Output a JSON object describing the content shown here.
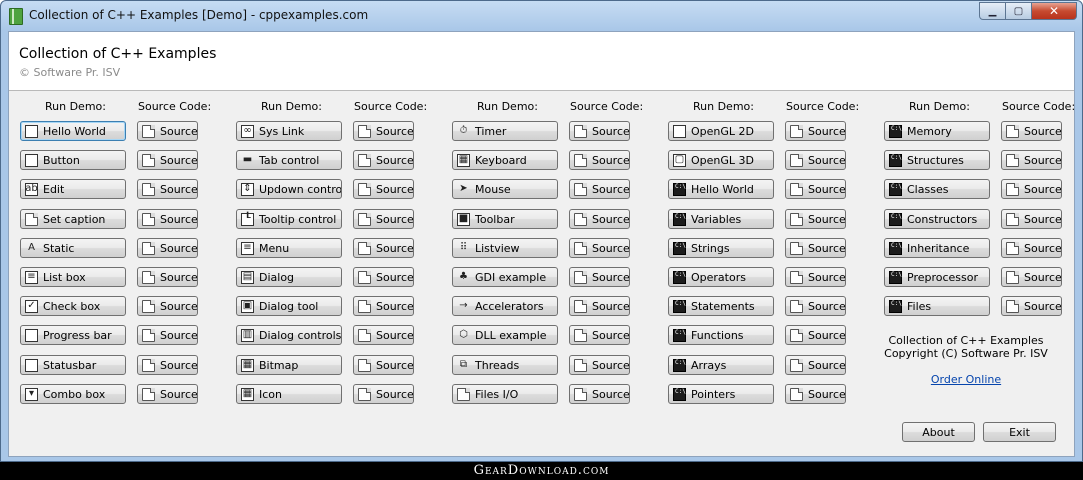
{
  "window": {
    "title": "Collection of C++ Examples [Demo]  - cppexamples.com"
  },
  "header": {
    "title": "Collection of C++ Examples",
    "subtitle": "© Software Pr. ISV"
  },
  "labels": {
    "run_demo": "Run Demo:",
    "source_code": "Source Code:",
    "source": "Source"
  },
  "columns": [
    {
      "items": [
        {
          "label": "Hello World",
          "icon": "window-icon"
        },
        {
          "label": "Button",
          "icon": "button-icon"
        },
        {
          "label": "Edit",
          "icon": "edit-icon"
        },
        {
          "label": "Set caption",
          "icon": "caption-icon"
        },
        {
          "label": "Static",
          "icon": "static-text-icon"
        },
        {
          "label": "List box",
          "icon": "listbox-icon"
        },
        {
          "label": "Check box",
          "icon": "checkbox-icon"
        },
        {
          "label": "Progress bar",
          "icon": "progress-icon"
        },
        {
          "label": "Statusbar",
          "icon": "statusbar-icon"
        },
        {
          "label": "Combo box",
          "icon": "combobox-icon"
        }
      ]
    },
    {
      "items": [
        {
          "label": "Sys Link",
          "icon": "link-icon"
        },
        {
          "label": "Tab control",
          "icon": "tab-icon"
        },
        {
          "label": "Updown control",
          "icon": "updown-icon"
        },
        {
          "label": "Tooltip control",
          "icon": "tooltip-icon"
        },
        {
          "label": "Menu",
          "icon": "menu-icon"
        },
        {
          "label": "Dialog",
          "icon": "dialog-icon"
        },
        {
          "label": "Dialog tool",
          "icon": "dialog-tool-icon"
        },
        {
          "label": "Dialog controls",
          "icon": "dialog-controls-icon"
        },
        {
          "label": "Bitmap",
          "icon": "bitmap-icon"
        },
        {
          "label": "Icon",
          "icon": "icon-icon"
        }
      ]
    },
    {
      "items": [
        {
          "label": "Timer",
          "icon": "timer-icon"
        },
        {
          "label": "Keyboard",
          "icon": "keyboard-icon"
        },
        {
          "label": "Mouse",
          "icon": "mouse-cursor-icon"
        },
        {
          "label": "Toolbar",
          "icon": "toolbar-icon"
        },
        {
          "label": "Listview",
          "icon": "listview-icon"
        },
        {
          "label": "GDI example",
          "icon": "gdi-icon"
        },
        {
          "label": "Accelerators",
          "icon": "arrow-right-icon"
        },
        {
          "label": "DLL example",
          "icon": "dll-icon"
        },
        {
          "label": "Threads",
          "icon": "threads-icon"
        },
        {
          "label": "Files I/O",
          "icon": "file-icon"
        }
      ]
    },
    {
      "items": [
        {
          "label": "OpenGL 2D",
          "icon": "opengl-2d-icon"
        },
        {
          "label": "OpenGL 3D",
          "icon": "opengl-3d-icon"
        },
        {
          "label": "Hello World",
          "icon": "console-icon"
        },
        {
          "label": "Variables",
          "icon": "console-icon"
        },
        {
          "label": "Strings",
          "icon": "console-icon"
        },
        {
          "label": "Operators",
          "icon": "console-icon"
        },
        {
          "label": "Statements",
          "icon": "console-icon"
        },
        {
          "label": "Functions",
          "icon": "console-icon"
        },
        {
          "label": "Arrays",
          "icon": "console-icon"
        },
        {
          "label": "Pointers",
          "icon": "console-icon"
        }
      ]
    },
    {
      "items": [
        {
          "label": "Memory",
          "icon": "console-icon"
        },
        {
          "label": "Structures",
          "icon": "console-icon"
        },
        {
          "label": "Classes",
          "icon": "console-icon"
        },
        {
          "label": "Constructors",
          "icon": "console-icon"
        },
        {
          "label": "Inheritance",
          "icon": "console-icon"
        },
        {
          "label": "Preprocessor",
          "icon": "console-icon"
        },
        {
          "label": "Files",
          "icon": "console-icon"
        }
      ]
    }
  ],
  "info": {
    "line1": "Collection of C++ Examples",
    "line2": "Copyright (C) Software Pr. ISV",
    "link": "Order Online"
  },
  "buttons": {
    "about": "About",
    "exit": "Exit"
  },
  "footer": {
    "watermark": "GearDownload.com"
  }
}
